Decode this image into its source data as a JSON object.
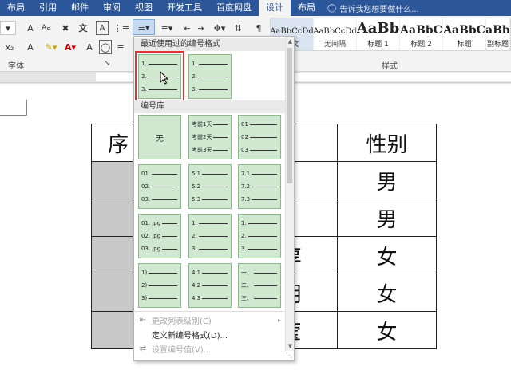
{
  "tabs": [
    "布局",
    "引用",
    "邮件",
    "审阅",
    "视图",
    "开发工具",
    "百度网盘",
    "设计",
    "布局"
  ],
  "active_tab_index": 7,
  "tell_me": "告诉我您想要做什么...",
  "ribbon": {
    "font_group_label": "字体",
    "styles_group_label": "样式",
    "icons": [
      "bold-A-icon",
      "highlight-icon",
      "font-color-icon",
      "bullets-icon",
      "numbering-icon",
      "multilevel-icon",
      "decrease-indent-icon",
      "increase-indent-icon",
      "sort-icon",
      "show-marks-icon"
    ],
    "style_gallery": [
      {
        "sample": "AaBbCcDd",
        "name": "正文"
      },
      {
        "sample": "AaBbCcDd",
        "name": "无间隔"
      },
      {
        "sample": "AaBb",
        "name": "标题 1"
      },
      {
        "sample": "AaBbC",
        "name": "标题 2"
      },
      {
        "sample": "AaBbC",
        "name": "标题"
      },
      {
        "sample": "AaBbC",
        "name": "副标题"
      }
    ]
  },
  "table": {
    "header": [
      "序",
      "",
      "性别"
    ],
    "rows": [
      {
        "name": "",
        "gender": "男"
      },
      {
        "name": "",
        "gender": "男"
      },
      {
        "name": "淳",
        "gender": "女"
      },
      {
        "name": "玥",
        "gender": "女"
      },
      {
        "name": "莹",
        "gender": "女"
      }
    ]
  },
  "numbering_dropdown": {
    "recent_header": "最近使用过的编号格式",
    "library_header": "编号库",
    "recent": [
      {
        "markers": [
          "1.",
          "2.",
          "3."
        ],
        "selected": true
      },
      {
        "markers": [
          "1.",
          "2.",
          "3."
        ],
        "selected": false
      }
    ],
    "library": [
      {
        "none": true,
        "label": "无"
      },
      {
        "markers": [
          "考前1天",
          "考前2天",
          "考前3天"
        ]
      },
      {
        "markers": [
          "01",
          "02",
          "03"
        ]
      },
      {
        "markers": [
          "01.",
          "02.",
          "03."
        ]
      },
      {
        "markers": [
          "5.1",
          "5.2",
          "5.3"
        ]
      },
      {
        "markers": [
          "7.1",
          "7.2",
          "7.3"
        ]
      },
      {
        "markers": [
          "01. jpg",
          "02. jpg",
          "03. jpg"
        ]
      },
      {
        "markers": [
          "1.",
          "2.",
          "3."
        ]
      },
      {
        "markers": [
          "1.",
          "2.",
          "3."
        ]
      },
      {
        "markers": [
          "1)",
          "2)",
          "3)"
        ]
      },
      {
        "markers": [
          "4.1",
          "4.2",
          "4.3"
        ]
      },
      {
        "markers": [
          "一、",
          "二、",
          "三、"
        ]
      }
    ],
    "menu": [
      {
        "label": "更改列表级别(C)",
        "disabled": true,
        "icon": "change-level-icon"
      },
      {
        "label": "定义新编号格式(D)...",
        "disabled": false,
        "icon": ""
      },
      {
        "label": "设置编号值(V)...",
        "disabled": true,
        "icon": "set-value-icon"
      }
    ]
  }
}
